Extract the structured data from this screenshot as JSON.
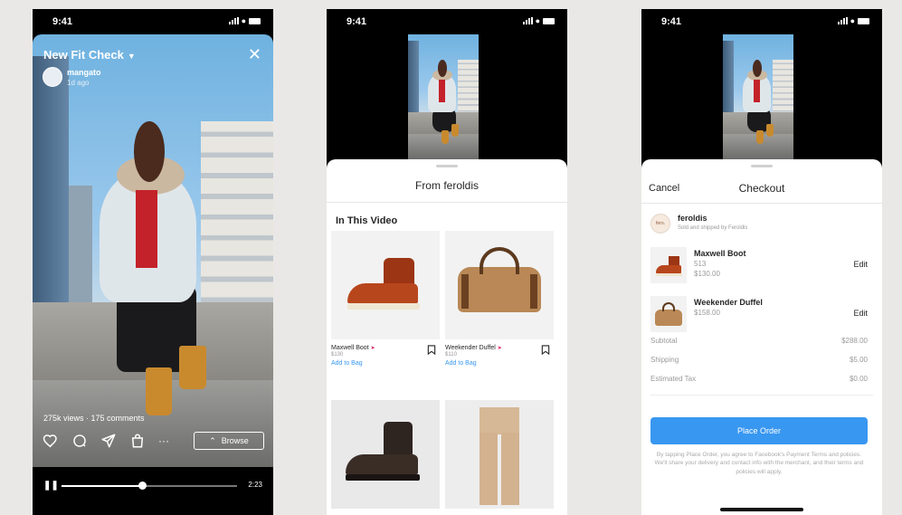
{
  "status": {
    "time": "9:41"
  },
  "screen1": {
    "title": "New Fit Check",
    "username": "mangato",
    "posted": "1d ago",
    "stats": "275k views · 175 comments",
    "browse_label": "Browse",
    "duration": "2:23",
    "progress": 0.46,
    "icons": [
      "heart-icon",
      "comment-icon",
      "share-icon",
      "shopping-bag-icon",
      "more-icon"
    ]
  },
  "screen2": {
    "sheet_title": "From feroldis",
    "section_title": "In This Video",
    "products": [
      {
        "name": "Maxwell Boot",
        "price": "$130",
        "action": "Add to Bag"
      },
      {
        "name": "Weekender Duffel",
        "price": "$110",
        "action": "Add to Bag"
      },
      {
        "name": "",
        "price": "",
        "action": ""
      },
      {
        "name": "",
        "price": "",
        "action": ""
      }
    ]
  },
  "screen3": {
    "cancel": "Cancel",
    "title": "Checkout",
    "seller_name": "feroldis",
    "seller_sub": "Sold and shipped by Feroldis",
    "seller_logo": "fero.",
    "items": [
      {
        "name": "Maxwell Boot",
        "size": "513",
        "price": "$130.00",
        "action": "Edit"
      },
      {
        "name": "Weekender Duffel",
        "size": "$158.00",
        "price": "",
        "action": "Edit"
      }
    ],
    "summary": [
      {
        "label": "Subtotal",
        "value": "$288.00"
      },
      {
        "label": "Shipping",
        "value": "$5.00"
      },
      {
        "label": "Estimated Tax",
        "value": "$0.00"
      }
    ],
    "place_order": "Place Order",
    "legal": "By tapping Place Order, you agree to Facebook's Payment Terms and policies. We'll share your delivery and contact info with the merchant, and their terms and policies will apply."
  },
  "colors": {
    "accent": "#3897f0",
    "sale": "#e0245e"
  }
}
